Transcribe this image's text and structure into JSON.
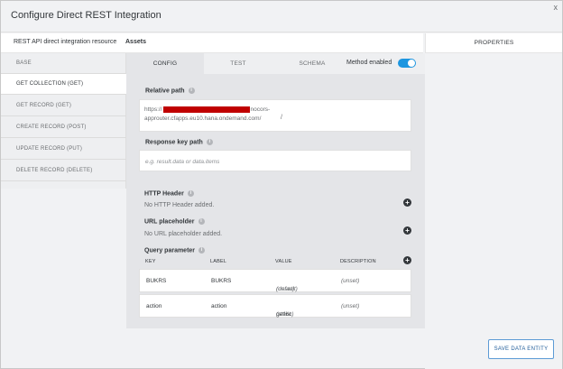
{
  "dialog": {
    "title": "Configure Direct REST Integration",
    "close": "x"
  },
  "resource": {
    "label": "REST API direct integration resource",
    "value": "Assets"
  },
  "properties": {
    "header": "PROPERTIES"
  },
  "sidebar": {
    "items": [
      {
        "label": "BASE"
      },
      {
        "label": "GET COLLECTION (GET)"
      },
      {
        "label": "GET RECORD (GET)"
      },
      {
        "label": "CREATE RECORD (POST)"
      },
      {
        "label": "UPDATE RECORD (PUT)"
      },
      {
        "label": "DELETE RECORD (DELETE)"
      }
    ]
  },
  "tabs": [
    {
      "label": "CONFIG"
    },
    {
      "label": "TEST"
    },
    {
      "label": "SCHEMA"
    }
  ],
  "method": {
    "label": "Method enabled",
    "enabled": true,
    "accent": "#1d96e0"
  },
  "relative_path": {
    "label": "Relative path",
    "url_prefix": "https://",
    "url_part2": "nocors-approuter.cfapps.eu10.hana.ondemand.com/",
    "suffix": "/"
  },
  "response_key_path": {
    "label": "Response key path",
    "placeholder": "e.g. result.data or data.items"
  },
  "http_header": {
    "title": "HTTP Header",
    "empty": "No HTTP Header added."
  },
  "url_placeholder": {
    "title": "URL placeholder",
    "empty": "No URL placeholder added."
  },
  "query_parameter": {
    "title": "Query parameter",
    "columns": {
      "key": "KEY",
      "label": "LABEL",
      "value": "VALUE",
      "description": "DESCRIPTION"
    },
    "rows": [
      {
        "key": "BUKRS",
        "label": "BUKRS",
        "value": "(unset)",
        "value_note": "(default)",
        "description": "(unset)"
      },
      {
        "key": "action",
        "label": "action",
        "value": "getlist",
        "value_note": "(static)",
        "description": "(unset)"
      }
    ]
  },
  "footer": {
    "save_label": "SAVE DATA ENTITY"
  }
}
